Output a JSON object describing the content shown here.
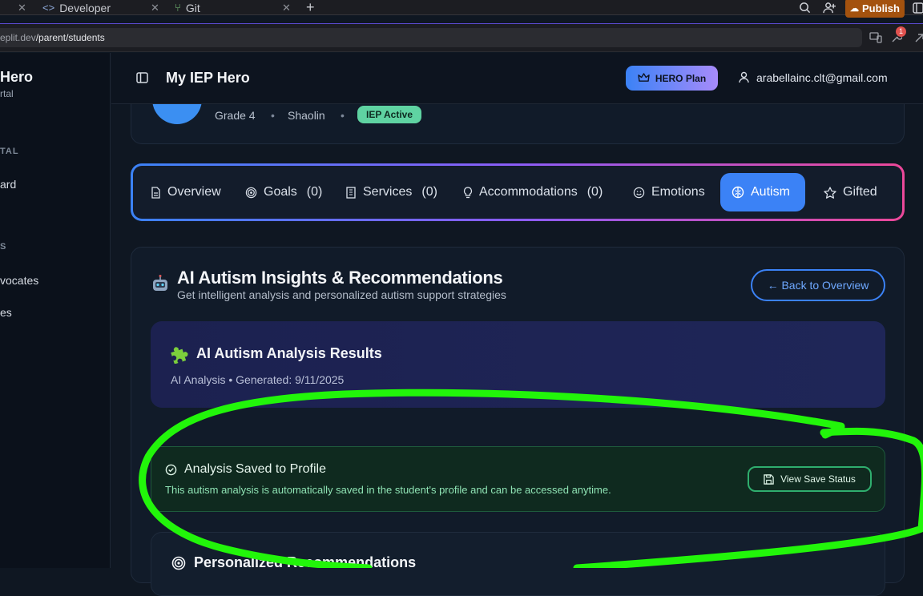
{
  "browser": {
    "tabs": [
      {
        "label": "Developer"
      },
      {
        "label": "Git"
      }
    ],
    "url_prefix": "eplit.dev",
    "url_path": "/parent/students",
    "publish_label": "Publish",
    "notification_count": "1"
  },
  "sidebar": {
    "brand": "Hero",
    "subtitle": "rtal",
    "section_1": "TAL",
    "item_1": "ard",
    "section_2": "S",
    "item_2": "vocates",
    "item_3": "es"
  },
  "header": {
    "title": "My IEP Hero",
    "plan_label": "HERO Plan",
    "user_email": "arabellainc.clt@gmail.com"
  },
  "student": {
    "grade": "Grade 4",
    "school": "Shaolin",
    "status_badge": "IEP Active"
  },
  "tabs": [
    {
      "label": "Overview",
      "count": ""
    },
    {
      "label": "Goals",
      "count": "(0)"
    },
    {
      "label": "Services",
      "count": "(0)"
    },
    {
      "label": "Accommodations",
      "count": "(0)"
    },
    {
      "label": "Emotions",
      "count": ""
    },
    {
      "label": "Autism",
      "count": ""
    },
    {
      "label": "Gifted",
      "count": ""
    }
  ],
  "panel": {
    "title": "AI Autism Insights & Recommendations",
    "subtitle": "Get intelligent analysis and personalized autism support strategies",
    "back_label": "← Back to Overview"
  },
  "results": {
    "title": "AI Autism Analysis Results",
    "meta": "AI Analysis • Generated: 9/11/2025"
  },
  "saved": {
    "title": "Analysis Saved to Profile",
    "description": "This autism analysis is automatically saved in the student's profile and can be accessed anytime.",
    "button_label": "View Save Status"
  },
  "recommendations": {
    "title": "Personalized Recommendations"
  },
  "colors": {
    "accent": "#3b82f6",
    "highlight_scribble": "#22f50a",
    "success": "#2fae6e"
  }
}
